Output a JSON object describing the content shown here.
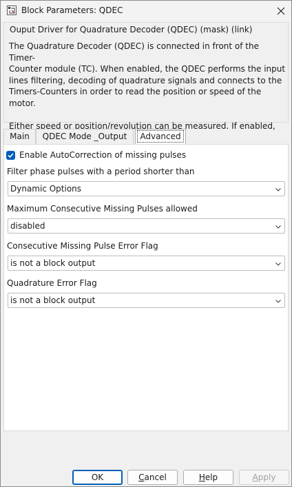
{
  "window": {
    "title": "Block Parameters: QDEC",
    "icon": "block-parameters-icon",
    "close_icon": "close-icon"
  },
  "mask": {
    "title": "Ouput Driver for Quadrature Decoder (QDEC)  (mask) (link)",
    "description": "The Quadrature Decoder (QDEC) is connected in front of the Timer-\nCounter module (TC). When enabled, the QDEC performs the input\nlines filtering, decoding of quadrature signals and connects to the\nTimers-Counters in order to read the position or speed of the motor.\n\nEither speed or position/revolution can be measured. If enabled, the\nPulse Counter for Index signal (IDX) can be read in any mode."
  },
  "tabs": [
    {
      "label": "Main",
      "active": false
    },
    {
      "label_pre": "QDEC Mode ",
      "label_ul": "_",
      "label_post": "Output",
      "active": false
    },
    {
      "label": "Advanced",
      "active": true
    }
  ],
  "advanced": {
    "autocorrect": {
      "label": "Enable AutoCorrection of missing pulses",
      "checked": true
    },
    "filter": {
      "label": "Filter phase pulses with a period shorter than",
      "value": "Dynamic Options"
    },
    "max_missing": {
      "label": "Maximum Consecutive Missing Pulses allowed",
      "value": "disabled"
    },
    "missing_flag": {
      "label": "Consecutive Missing Pulse Error Flag",
      "value": "is not a block output"
    },
    "quad_error": {
      "label": "Quadrature Error Flag",
      "value": "is not a block output"
    }
  },
  "buttons": {
    "ok": "OK",
    "cancel_u": "C",
    "cancel_rest": "ancel",
    "help_u": "H",
    "help_rest": "elp",
    "apply_u": "A",
    "apply_rest": "pply"
  },
  "colors": {
    "accent": "#005fb8"
  }
}
